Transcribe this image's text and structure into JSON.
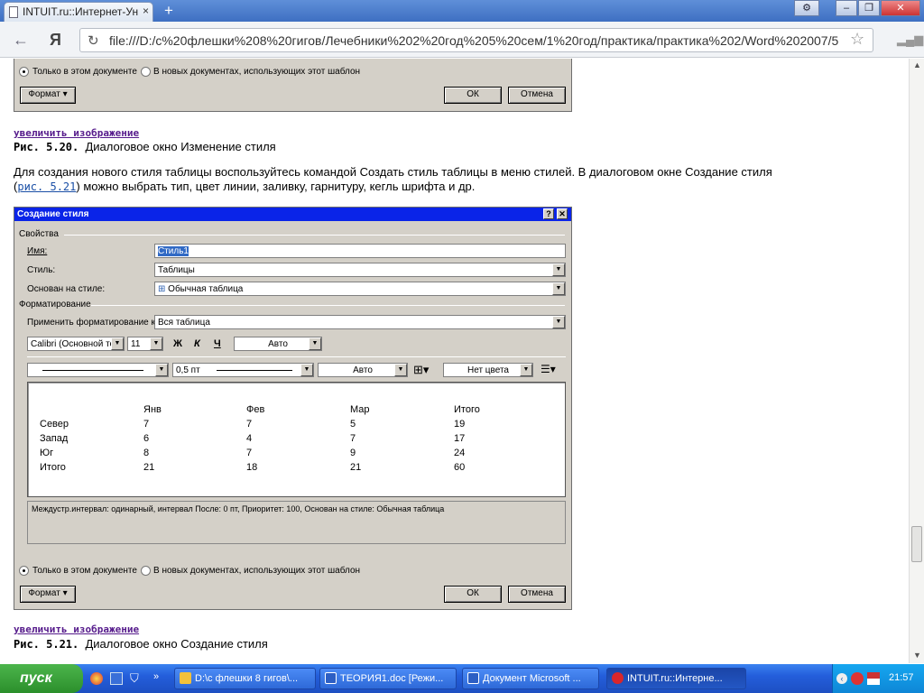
{
  "browser": {
    "tab_title": "INTUIT.ru::Интернет-Ун",
    "tab_close": "×",
    "new_tab": "+",
    "search_logo": "Я",
    "url": "file:///D:/c%20флешки%208%20гигов/Лечебники%202%20год%205%20сем/1%20год/практика/практика%202/Word%202007/5",
    "controls": {
      "settings": "⚙",
      "minimize": "–",
      "restore": "❐",
      "close": "✕"
    }
  },
  "dialog_top": {
    "radio_this_doc": "Только в этом документе",
    "radio_new_docs": "В новых документах, использующих этот шаблон",
    "format_button": "Формат ▾",
    "ok_button": "ОК",
    "cancel_button": "Отмена"
  },
  "fig_520": {
    "zoom_link": "увеличить изображение",
    "number": "Рис. 5.20.",
    "caption": "Диалоговое окно Изменение стиля"
  },
  "paragraph": {
    "part1": "Для создания нового стиля таблицы воспользуйтесь командой Создать стиль таблицы в меню стилей. В диалоговом окне Создание стиля",
    "paren_open": "(",
    "ref": "рис. 5.21",
    "part2": ") можно выбрать тип, цвет линии, заливку, гарнитуру, кегль шрифта и др."
  },
  "dialog": {
    "title": "Создание стиля",
    "help_btn": "?",
    "close_btn": "✕",
    "group_properties": "Свойства",
    "name_label": "Имя:",
    "name_value": "Стиль1",
    "style_label": "Стиль:",
    "style_value": "Таблицы",
    "based_label": "Основан на стиле:",
    "based_value": "Обычная таблица",
    "group_formatting": "Форматирование",
    "apply_label": "Применить форматирование к:",
    "apply_value": "Вся таблица",
    "font_value": "Calibri (Основной текс",
    "size_value": "11",
    "bold": "Ж",
    "italic": "К",
    "underline": "Ч",
    "color_value": "Авто",
    "line_width": "0,5 пт",
    "line_color": "Авто",
    "fill_value": "Нет цвета",
    "preview_table": {
      "headers": [
        "",
        "Янв",
        "Фев",
        "Мар",
        "Итого"
      ],
      "rows": [
        [
          "Север",
          "7",
          "7",
          "5",
          "19"
        ],
        [
          "Запад",
          "6",
          "4",
          "7",
          "17"
        ],
        [
          "Юг",
          "8",
          "7",
          "9",
          "24"
        ],
        [
          "Итого",
          "21",
          "18",
          "21",
          "60"
        ]
      ]
    },
    "description": "Междустр.интервал:  одинарный, интервал После:  0 пт, Приоритет: 100, Основан на стиле: Обычная таблица",
    "radio_this_doc": "Только в этом документе",
    "radio_new_docs": "В новых документах, использующих этот шаблон",
    "format_button": "Формат ▾",
    "ok_button": "ОК",
    "cancel_button": "Отмена"
  },
  "fig_521": {
    "zoom_link": "увеличить изображение",
    "number": "Рис. 5.21.",
    "caption": "Диалоговое окно Создание стиля"
  },
  "taskbar": {
    "start": "пуск",
    "tasks": [
      {
        "label": "D:\\c флешки 8 гигов\\...",
        "color": "#f3c13a"
      },
      {
        "label": "ТЕОРИЯ1.doc [Режи...",
        "color": "#2d5fc4"
      },
      {
        "label": "Документ Microsoft ...",
        "color": "#2d5fc4"
      },
      {
        "label": "INTUIT.ru::Интерне...",
        "color": "#d9262b"
      }
    ],
    "clock": "21:57"
  }
}
